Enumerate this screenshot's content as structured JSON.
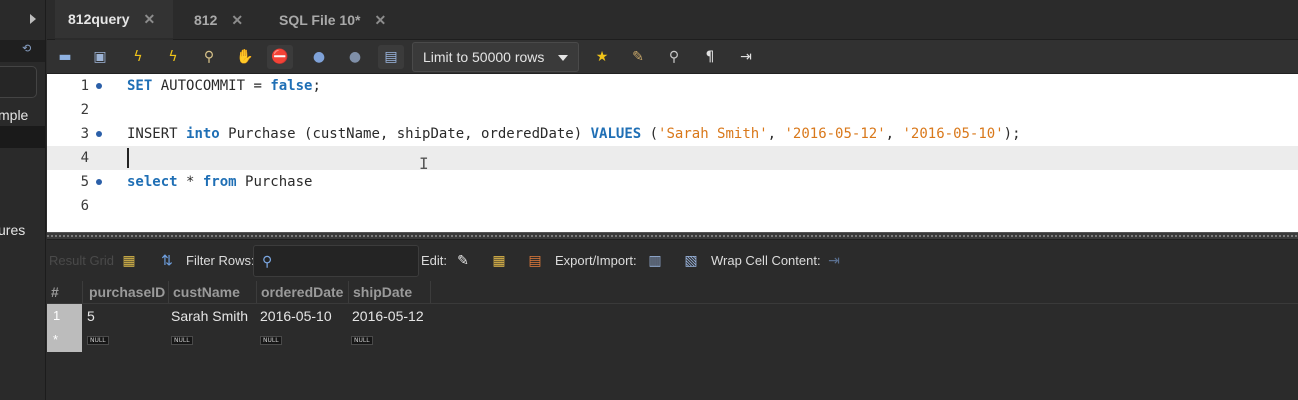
{
  "sidebar": {
    "labels": [
      "mple",
      "ures"
    ]
  },
  "tabs": [
    {
      "label": "812query",
      "active": true
    },
    {
      "label": "812",
      "active": false
    },
    {
      "label": "SQL File 10*",
      "active": false
    }
  ],
  "toolbar": {
    "limit_label": "Limit to 50000 rows",
    "icons": [
      "open-folder-icon",
      "save-icon",
      "execute-icon",
      "execute-current-icon",
      "explain-icon",
      "stop-icon",
      "toggle-error-icon",
      "commit-icon",
      "rollback-icon",
      "autocommit-icon",
      "bookmark-icon",
      "beautify-icon",
      "find-icon",
      "invisibles-icon",
      "wrap-icon"
    ]
  },
  "editor": {
    "line_numbers": [
      "1",
      "2",
      "3",
      "4",
      "5",
      "6"
    ],
    "line1": {
      "kw1": "SET",
      "plain": " AUTOCOMMIT = ",
      "kw2": "false",
      "end": ";"
    },
    "line3": {
      "kw1": "INSERT",
      "sp1": " ",
      "kw2": "into",
      "plain": " Purchase (custName, shipDate, orderedDate) ",
      "kw3": "VALUES",
      "open": " (",
      "s1": "'Sarah Smith'",
      "c1": ", ",
      "s2": "'2016-05-12'",
      "c2": ", ",
      "s3": "'2016-05-10'",
      "end": ");"
    },
    "line5": {
      "kw1": "select",
      "plain1": " * ",
      "kw2": "from",
      "plain2": " Purchase"
    }
  },
  "result_toolbar": {
    "result_grid_label": "Result Grid",
    "filter_label": "Filter Rows:",
    "filter_placeholder": "",
    "edit_label": "Edit:",
    "export_label": "Export/Import:",
    "wrap_label": "Wrap Cell Content:"
  },
  "grid": {
    "columns": [
      "#",
      "purchaseID",
      "custName",
      "orderedDate",
      "shipDate"
    ],
    "rows": [
      {
        "num": "1",
        "purchaseID": "5",
        "custName": "Sarah Smith",
        "orderedDate": "2016-05-10",
        "shipDate": "2016-05-12"
      }
    ],
    "new_row_marker": "*",
    "null_label": "NULL"
  }
}
